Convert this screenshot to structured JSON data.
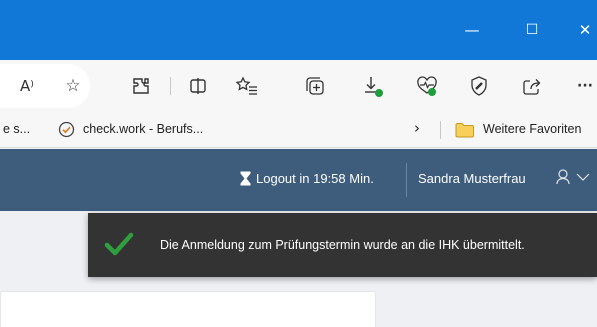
{
  "window": {
    "controls": {
      "minimize": "—",
      "maximize": "☐",
      "close": "✕"
    },
    "titlebar_color": "#1278d8"
  },
  "toolbar": {
    "icons": [
      "read-aloud-icon",
      "favorite-star-icon",
      "extensions-icon",
      "split-screen-icon",
      "favorites-list-icon",
      "collections-icon",
      "downloads-icon",
      "performance-icon",
      "browser-essentials-icon",
      "share-icon",
      "more-icon"
    ],
    "read_aloud_glyph": "A⁾",
    "more_glyph": "···"
  },
  "favorites_bar": {
    "items": [
      {
        "label": "e s...",
        "icon": ""
      },
      {
        "label": "check.work - Berufs...",
        "icon": "check-circle-icon"
      }
    ],
    "overflow_glyph": "›",
    "other_favorites_label": "Weitere Favoriten"
  },
  "app_header": {
    "logout_label": "Logout in 19:58 Min.",
    "user_name": "Sandra Musterfrau",
    "background_color": "#3e5c7b"
  },
  "toast": {
    "message": "Die Anmeldung zum Prüfungstermin wurde an die IHK übermittelt.",
    "icon": "checkmark-icon",
    "check_color": "#2e9e3e"
  }
}
